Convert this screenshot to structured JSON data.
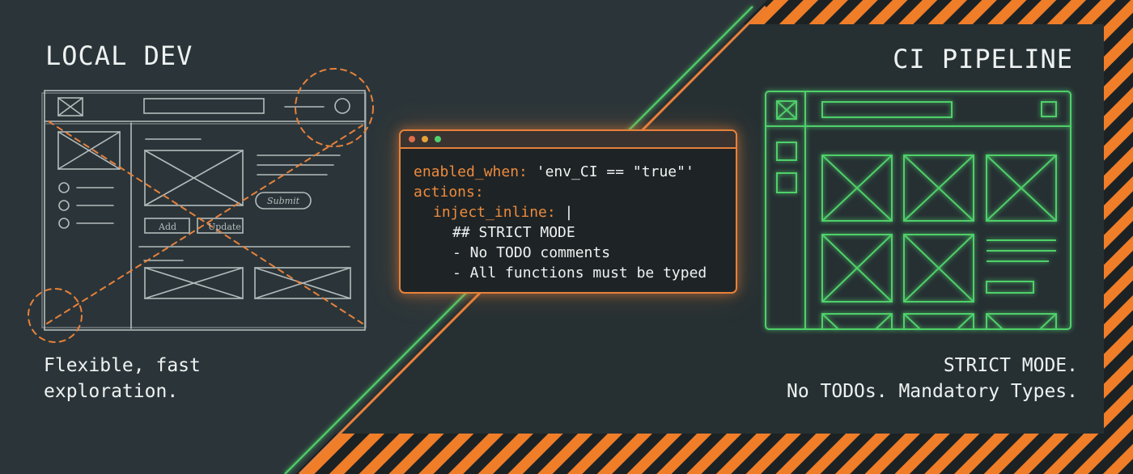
{
  "left_panel": {
    "title": "LOCAL DEV",
    "description_lines": [
      "Flexible, fast",
      "exploration."
    ],
    "sketch_labels": {
      "add": "Add",
      "update": "Update",
      "submit": "Submit"
    }
  },
  "right_panel": {
    "title": "CI PIPELINE",
    "description_lines": [
      "STRICT MODE.",
      "No TODOs. Mandatory Types."
    ]
  },
  "code_window": {
    "window_controls": [
      "close-dot",
      "minimize-dot",
      "maximize-dot"
    ],
    "lines": {
      "l1_key": "enabled_when:",
      "l1_val": " 'env_CI == \"true\"'",
      "l2_key": "actions:",
      "l3_key": "inject_inline:",
      "l3_val": " |",
      "l4": "## STRICT MODE",
      "l5": "- No TODO comments",
      "l6": "- All functions must be typed"
    }
  },
  "colors": {
    "background": "#2b3539",
    "accent_orange": "#e8813a",
    "accent_green": "#4fd06a",
    "sketch_gray": "#b4bcbd",
    "text": "#eef2f1",
    "dot_red": "#e06d4a",
    "dot_yellow": "#e8a13a",
    "dot_green": "#4fd06a"
  }
}
